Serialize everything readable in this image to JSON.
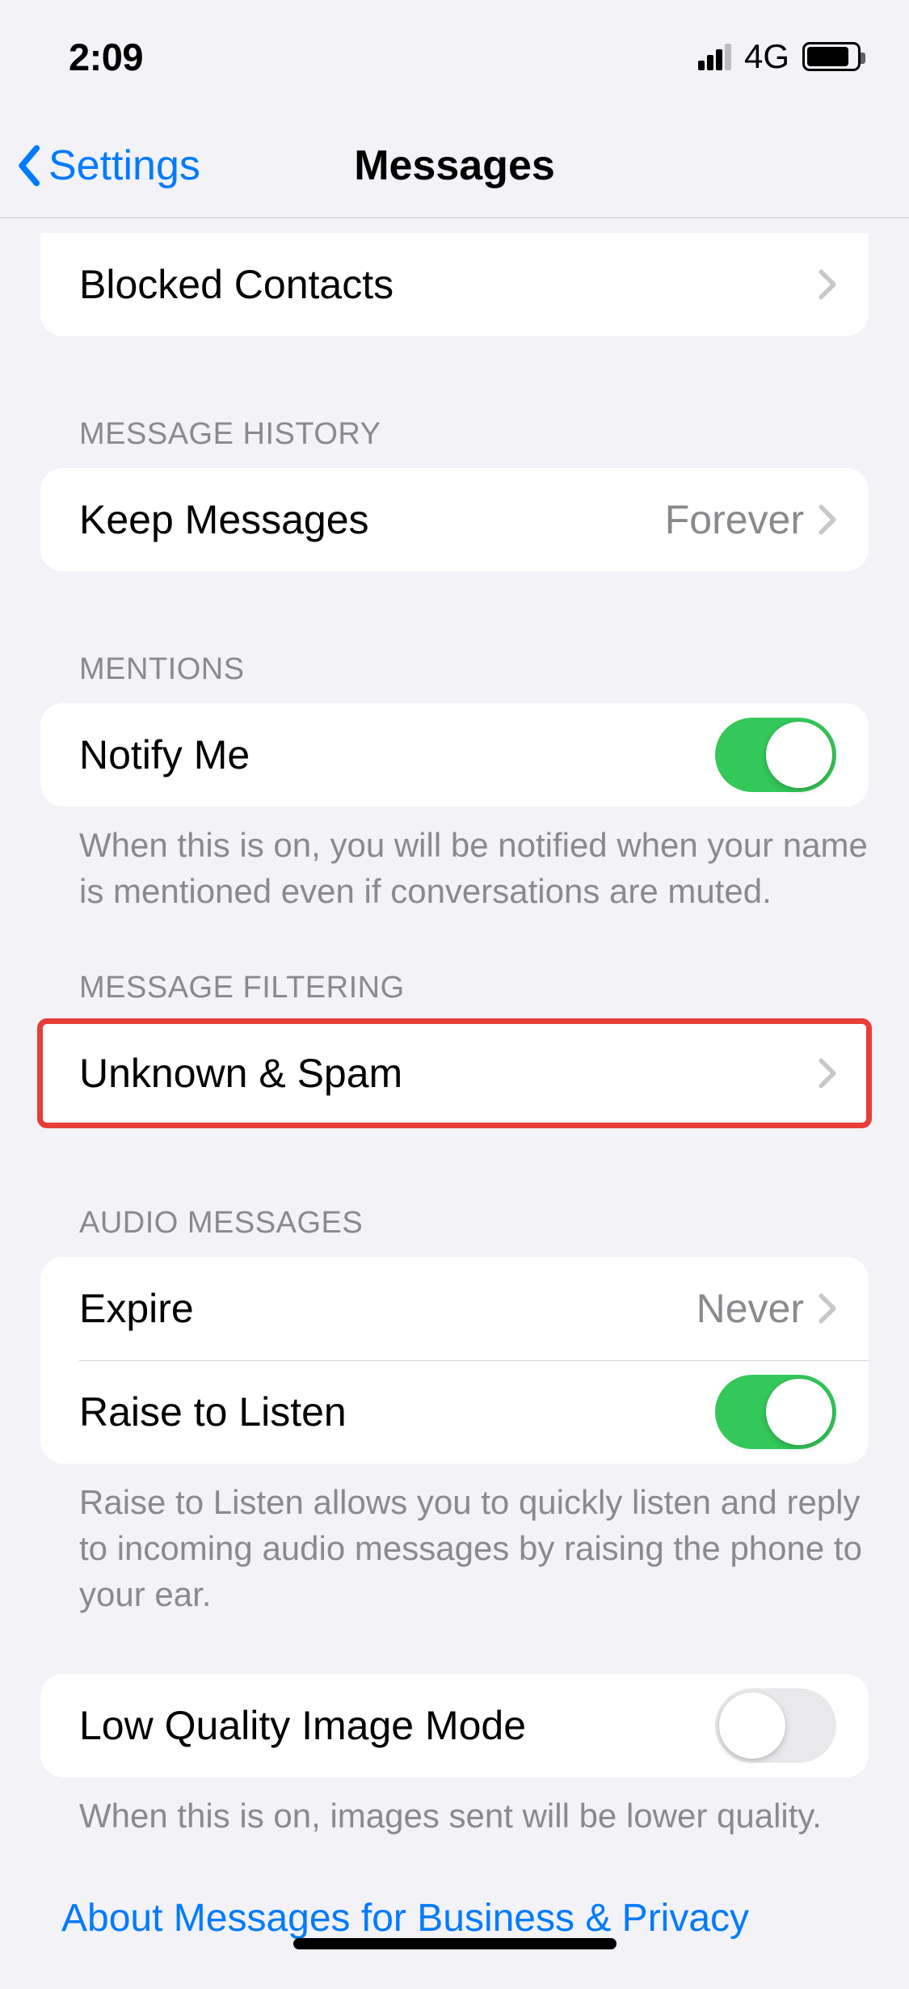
{
  "status": {
    "time": "2:09",
    "network": "4G"
  },
  "nav": {
    "back": "Settings",
    "title": "Messages"
  },
  "blocked": {
    "label": "Blocked Contacts"
  },
  "history": {
    "header": "MESSAGE HISTORY",
    "keep_label": "Keep Messages",
    "keep_value": "Forever"
  },
  "mentions": {
    "header": "MENTIONS",
    "notify_label": "Notify Me",
    "notify_on": true,
    "footer": "When this is on, you will be notified when your name is mentioned even if conversations are muted."
  },
  "filtering": {
    "header": "MESSAGE FILTERING",
    "unknown_label": "Unknown & Spam"
  },
  "audio": {
    "header": "AUDIO MESSAGES",
    "expire_label": "Expire",
    "expire_value": "Never",
    "raise_label": "Raise to Listen",
    "raise_on": true,
    "footer": "Raise to Listen allows you to quickly listen and reply to incoming audio messages by raising the phone to your ear."
  },
  "image_mode": {
    "label": "Low Quality Image Mode",
    "on": false,
    "footer": "When this is on, images sent will be lower quality."
  },
  "about_link": "About Messages for Business & Privacy"
}
